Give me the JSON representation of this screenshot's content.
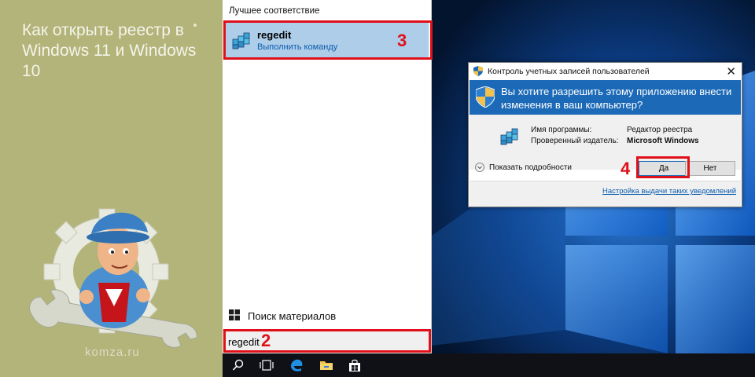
{
  "branding": {
    "article_title": "Как открыть реестр в Windows 11 и Windows 10",
    "site": "komza.ru",
    "panel_color": "#b3b47a"
  },
  "start_menu": {
    "section_header": "Лучшее соответствие",
    "best_match": {
      "name": "regedit",
      "subtitle": "Выполнить команду",
      "icon": "registry-editor-icon"
    },
    "search_documents_label": "Поиск материалов",
    "search_value": "regedit",
    "highlight_color": "#aecde9"
  },
  "annotations": {
    "step2": "2",
    "step3": "3",
    "step4": "4",
    "frame_color": "#e0101a"
  },
  "uac": {
    "title": "Контроль учетных записей пользователей",
    "question": "Вы хотите разрешить этому приложению внести изменения в ваш компьютер?",
    "program_name_label": "Имя программы:",
    "program_name_value": "Редактор реестра",
    "publisher_label": "Проверенный издатель:",
    "publisher_value": "Microsoft Windows",
    "show_details": "Показать подробности",
    "yes_button": "Да",
    "no_button": "Нет",
    "settings_link": "Настройка выдачи таких уведомлений",
    "banner_color": "#1c6ab7"
  },
  "taskbar": {
    "icons": [
      "search-icon",
      "task-view-icon",
      "edge-icon",
      "file-explorer-icon",
      "store-icon"
    ]
  }
}
